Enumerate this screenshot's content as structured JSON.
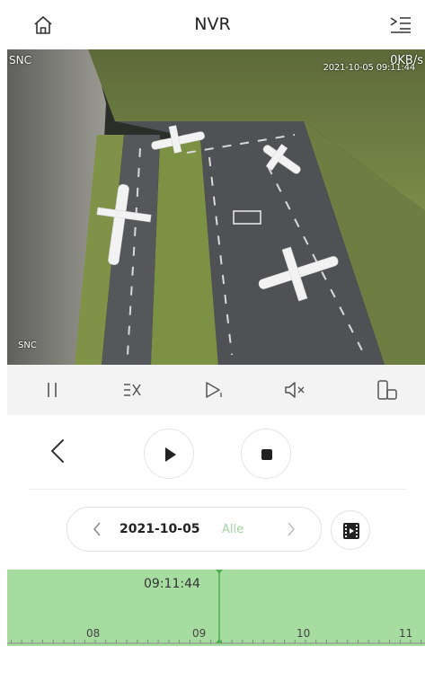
{
  "header": {
    "title": "NVR",
    "home_icon": "home-icon",
    "menu_icon": "list-menu-icon"
  },
  "video": {
    "channel_top": "SNC",
    "channel_bottom": "SNC",
    "bitrate": "0KB/s",
    "timestamp": "2021-10-05 09:11:44"
  },
  "controls": {
    "items": [
      "pause-icon",
      "stream-quality-icon",
      "playback-speed-icon",
      "mute-icon",
      "rotate-screen-icon"
    ]
  },
  "playback": {
    "back_icon": "chevron-left-icon",
    "play_icon": "play-icon",
    "stop_icon": "stop-icon"
  },
  "date_selector": {
    "date": "2021-10-05",
    "filter": "Alle",
    "prev_icon": "chevron-left-icon",
    "next_icon": "chevron-right-icon",
    "clip_icon": "film-clip-icon"
  },
  "timeline": {
    "cursor_time": "09:11:44",
    "hour_labels": [
      "08",
      "09",
      "10",
      "11"
    ],
    "accent": "#a6dca0",
    "cursor_color": "#4caf50"
  }
}
